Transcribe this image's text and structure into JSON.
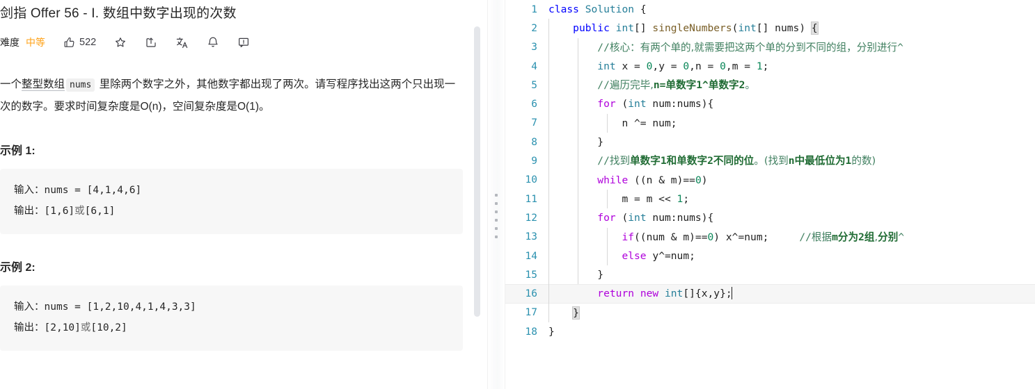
{
  "problem": {
    "title": "剑指 Offer 56 - I. 数组中数字出现的次数",
    "meta": {
      "difficulty_label": "难度",
      "difficulty_value": "中等",
      "difficulty_color": "#ffa116",
      "likes": "522",
      "icons": [
        "thumbs-up-icon",
        "star-icon",
        "share-icon",
        "translate-icon",
        "bell-icon",
        "report-icon"
      ]
    },
    "description": {
      "part1": "一个",
      "underlined": "整型数组",
      "code_token": "nums",
      "part2": " 里除两个数字之外，其他数字都出现了两次。请写程序找出这两个只出现一次的数字。要求时间复杂度是O(n)，空间复杂度是O(1)。"
    },
    "examples": [
      {
        "heading": "示例 1:",
        "input_label": "输入：",
        "input_value": "nums = [4,1,4,6]",
        "output_label": "输出：",
        "output_a": "[1,6]",
        "or": "或",
        "output_b": "[6,1]"
      },
      {
        "heading": "示例 2:",
        "input_label": "输入：",
        "input_value": "nums = [1,2,10,4,1,4,3,3]",
        "output_label": "输出：",
        "output_a": "[2,10]",
        "or": "或",
        "output_b": "[10,2]"
      }
    ]
  },
  "editor": {
    "language": "java",
    "active_line": 16,
    "lines": [
      {
        "n": "1",
        "indent": 0,
        "guides": 0
      },
      {
        "n": "2",
        "indent": 1,
        "guides": 1
      },
      {
        "n": "3",
        "indent": 2,
        "guides": 2
      },
      {
        "n": "4",
        "indent": 2,
        "guides": 2
      },
      {
        "n": "5",
        "indent": 2,
        "guides": 2
      },
      {
        "n": "6",
        "indent": 2,
        "guides": 2
      },
      {
        "n": "7",
        "indent": 3,
        "guides": 3
      },
      {
        "n": "8",
        "indent": 2,
        "guides": 2
      },
      {
        "n": "9",
        "indent": 2,
        "guides": 2
      },
      {
        "n": "10",
        "indent": 2,
        "guides": 2
      },
      {
        "n": "11",
        "indent": 3,
        "guides": 3
      },
      {
        "n": "12",
        "indent": 2,
        "guides": 2
      },
      {
        "n": "13",
        "indent": 3,
        "guides": 3
      },
      {
        "n": "14",
        "indent": 3,
        "guides": 3
      },
      {
        "n": "15",
        "indent": 2,
        "guides": 2
      },
      {
        "n": "16",
        "indent": 2,
        "guides": 1
      },
      {
        "n": "17",
        "indent": 1,
        "guides": 1
      },
      {
        "n": "18",
        "indent": 0,
        "guides": 0
      }
    ],
    "code": {
      "l1": "class Solution {",
      "l2": "    public int[] singleNumbers(int[] nums) {",
      "l3": "        //核心：有两个单的,就需要把这两个单的分到不同的组，分别进行^",
      "l4": "        int x = 0,y = 0,n = 0,m = 1;",
      "l5": "        //遍历完毕,n=单数字1^单数字2。",
      "l6": "        for (int num:nums){",
      "l7": "            n ^= num;",
      "l8": "        }",
      "l9": "        //找到单数字1和单数字2不同的位。(找到n中最低位为1的数)",
      "l10": "        while ((n & m)==0)",
      "l11": "            m = m << 1;",
      "l12": "        for (int num:nums){",
      "l13": "            if((num & m)==0) x^=num;     //根据m分为2组,分别^",
      "l14": "            else y^=num;",
      "l15": "        }",
      "l16": "        return new int[]{x,y};",
      "l17": "    }",
      "l18": "}"
    },
    "tokens": {
      "kw_class": "class",
      "name_solution": "Solution",
      "kw_public": "public",
      "kw_int": "int",
      "fn_singleNumbers": "singleNumbers",
      "var_nums": "nums",
      "kw_for": "for",
      "kw_while": "while",
      "kw_if": "if",
      "kw_else": "else",
      "kw_return": "return",
      "kw_new": "new"
    },
    "colors": {
      "keyword": "#0000ff",
      "control": "#af00db",
      "type": "#267f99",
      "function": "#795e26",
      "number": "#098658",
      "comment": "#3f7f5f",
      "linenumber": "#2b91af",
      "active_line_bg": "#f6f6f6"
    }
  }
}
